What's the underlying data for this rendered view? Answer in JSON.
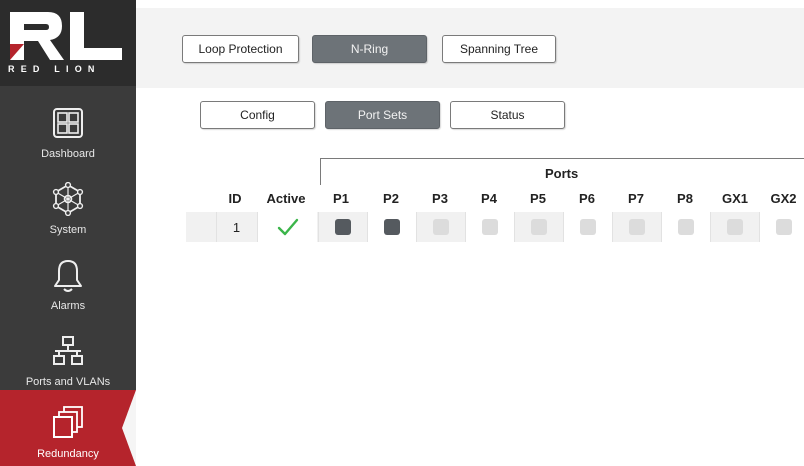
{
  "brand": {
    "name": "RED LION",
    "accent": "#b5242c"
  },
  "sidebar": {
    "items": [
      {
        "label": "Dashboard",
        "icon": "dashboard-icon"
      },
      {
        "label": "System",
        "icon": "network-hub-icon"
      },
      {
        "label": "Alarms",
        "icon": "bell-icon"
      },
      {
        "label": "Ports and VLANs",
        "icon": "network-topology-icon"
      },
      {
        "label": "Redundancy",
        "icon": "stacked-windows-icon",
        "active": true
      }
    ]
  },
  "top_tabs": [
    {
      "label": "Loop Protection"
    },
    {
      "label": "N-Ring",
      "selected": true
    },
    {
      "label": "Spanning Tree"
    }
  ],
  "sub_tabs": [
    {
      "label": "Config"
    },
    {
      "label": "Port Sets",
      "selected": true
    },
    {
      "label": "Status"
    }
  ],
  "table": {
    "group_title": "Ports",
    "headers": {
      "id": "ID",
      "active": "Active",
      "ports": [
        "P1",
        "P2",
        "P3",
        "P4",
        "P5",
        "P6",
        "P7",
        "P8",
        "GX1",
        "GX2"
      ]
    },
    "rows": [
      {
        "id": "1",
        "active": true,
        "ports": [
          true,
          true,
          false,
          false,
          false,
          false,
          false,
          false,
          false,
          false
        ]
      }
    ]
  }
}
